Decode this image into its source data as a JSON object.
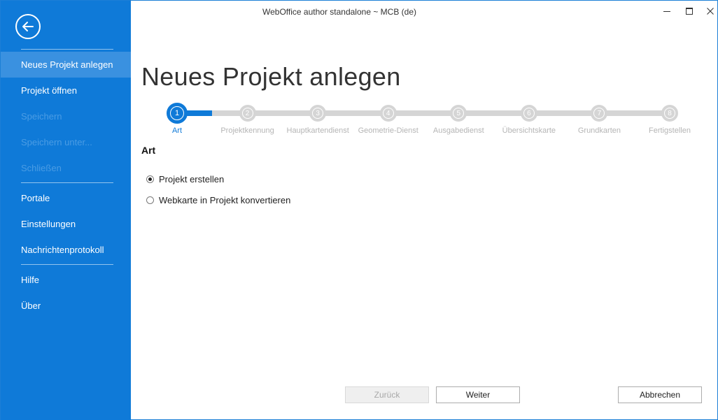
{
  "window": {
    "title": "WebOffice author standalone ~ MCB (de)"
  },
  "sidebar": {
    "items": [
      {
        "label": "Neues Projekt anlegen",
        "state": "active"
      },
      {
        "label": "Projekt öffnen",
        "state": "normal"
      },
      {
        "label": "Speichern",
        "state": "disabled"
      },
      {
        "label": "Speichern unter...",
        "state": "disabled"
      },
      {
        "label": "Schließen",
        "state": "disabled"
      },
      {
        "label": "Portale",
        "state": "normal"
      },
      {
        "label": "Einstellungen",
        "state": "normal"
      },
      {
        "label": "Nachrichtenprotokoll",
        "state": "normal"
      },
      {
        "label": "Hilfe",
        "state": "normal"
      },
      {
        "label": "Über",
        "state": "normal"
      }
    ]
  },
  "main": {
    "title": "Neues Projekt anlegen",
    "steps": [
      {
        "number": "1",
        "label": "Art",
        "active": true
      },
      {
        "number": "2",
        "label": "Projektkennung",
        "active": false
      },
      {
        "number": "3",
        "label": "Hauptkartendienst",
        "active": false
      },
      {
        "number": "4",
        "label": "Geometrie-Dienst",
        "active": false
      },
      {
        "number": "5",
        "label": "Ausgabedienst",
        "active": false
      },
      {
        "number": "6",
        "label": "Übersichtskarte",
        "active": false
      },
      {
        "number": "7",
        "label": "Grundkarten",
        "active": false
      },
      {
        "number": "8",
        "label": "Fertigstellen",
        "active": false
      }
    ],
    "section_title": "Art",
    "options": [
      {
        "label": "Projekt erstellen",
        "selected": true
      },
      {
        "label": "Webkarte in Projekt konvertieren",
        "selected": false
      }
    ]
  },
  "footer": {
    "back_label": "Zurück",
    "next_label": "Weiter",
    "cancel_label": "Abbrechen"
  },
  "colors": {
    "accent": "#0f7ad8",
    "sidebar_active": "#3a91e0",
    "inactive_step": "#d5d5d5"
  }
}
